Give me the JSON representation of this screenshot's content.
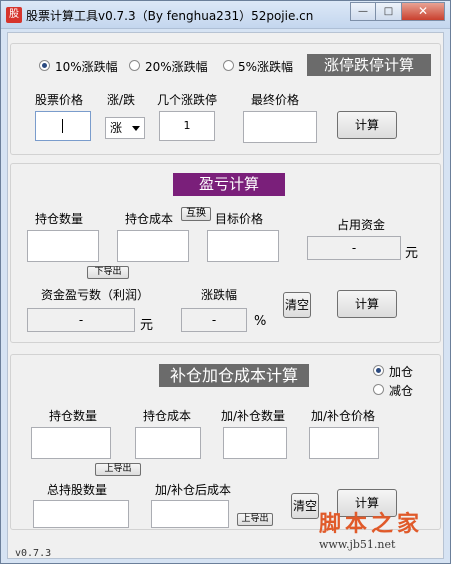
{
  "window": {
    "app_icon_text": "股",
    "title": "股票计算工具v0.7.3（By fenghua231）52pojie.cn",
    "minimize": "—",
    "maximize": "□",
    "close": "✕"
  },
  "section1": {
    "radio_10": "10%涨跌幅",
    "radio_20": "20%涨跌幅",
    "radio_5": "5%涨跌幅",
    "selected_radio": "10%涨跌幅",
    "title": "涨停跌停计算",
    "title_bg": "#6b6b6b",
    "label_price": "股票价格",
    "label_direction": "涨/跌",
    "label_count": "几个涨跌停",
    "label_final": "最终价格",
    "direction_value": "涨",
    "count_value": "1",
    "calc_button": "计算"
  },
  "section2": {
    "title": "盈亏计算",
    "title_bg": "#7a1f7a",
    "label_qty": "持仓数量",
    "label_cost": "持仓成本",
    "swap_button": "互换",
    "label_target": "目标价格",
    "label_capital": "占用资金",
    "capital_value": "-",
    "capital_unit": "元",
    "export_down": "下导出",
    "label_profit": "资金盈亏数（利润）",
    "profit_value": "-",
    "profit_unit": "元",
    "label_change": "涨跌幅",
    "change_value": "-",
    "change_unit": "%",
    "clear_button": "清空",
    "calc_button": "计算"
  },
  "section3": {
    "title": "补仓加仓成本计算",
    "title_bg": "#6b6b6b",
    "radio_add": "加仓",
    "radio_reduce": "减仓",
    "selected_radio": "加仓",
    "label_qty": "持仓数量",
    "label_cost": "持仓成本",
    "label_add_qty": "加/补仓数量",
    "label_add_price": "加/补仓价格",
    "export_up_1": "上导出",
    "label_total": "总持股数量",
    "label_after_cost": "加/补仓后成本",
    "export_up_2": "上导出",
    "clear_button": "清空",
    "calc_button": "计算"
  },
  "footer": {
    "version": "v0.7.3",
    "watermark_big": "脚本之家",
    "watermark_small": "www.jb51.net"
  }
}
